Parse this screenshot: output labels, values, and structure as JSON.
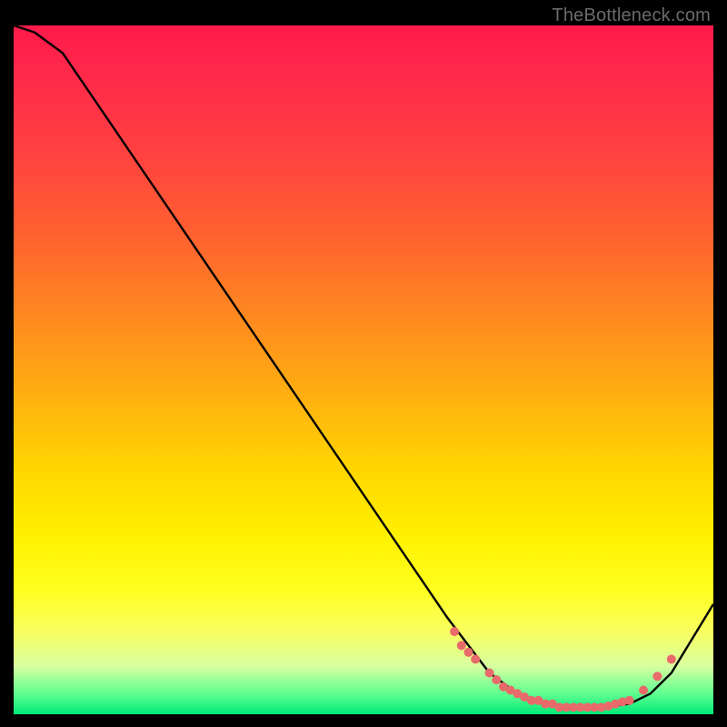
{
  "watermark": "TheBottleneck.com",
  "chart_data": {
    "type": "line",
    "title": "",
    "xlabel": "",
    "ylabel": "",
    "xlim": [
      0,
      100
    ],
    "ylim": [
      0,
      100
    ],
    "series": [
      {
        "name": "bottleneck-curve",
        "x": [
          0,
          3,
          7,
          62,
          68,
          72,
          76,
          80,
          84,
          88,
          91,
          94,
          97,
          100
        ],
        "values": [
          100,
          99,
          96,
          14,
          6,
          3,
          1.5,
          1,
          1,
          1.5,
          3,
          6,
          11,
          16
        ]
      }
    ],
    "markers": {
      "name": "highlight-dots",
      "color": "#e86a6a",
      "x": [
        63,
        64,
        65,
        66,
        68,
        69,
        70,
        71,
        72,
        73,
        74,
        75,
        76,
        77,
        78,
        79,
        80,
        81,
        82,
        83,
        84,
        85,
        86,
        87,
        88,
        90,
        92,
        94
      ],
      "values": [
        12,
        10,
        9,
        8,
        6,
        5,
        4,
        3.5,
        3,
        2.5,
        2,
        2,
        1.5,
        1.5,
        1,
        1,
        1,
        1,
        1,
        1,
        1,
        1.2,
        1.5,
        1.8,
        2,
        3.5,
        5.5,
        8
      ]
    },
    "background_gradient": {
      "top": "#ff1a4a",
      "bottom": "#00e878",
      "stops": [
        "red",
        "orange",
        "yellow",
        "green"
      ]
    }
  }
}
